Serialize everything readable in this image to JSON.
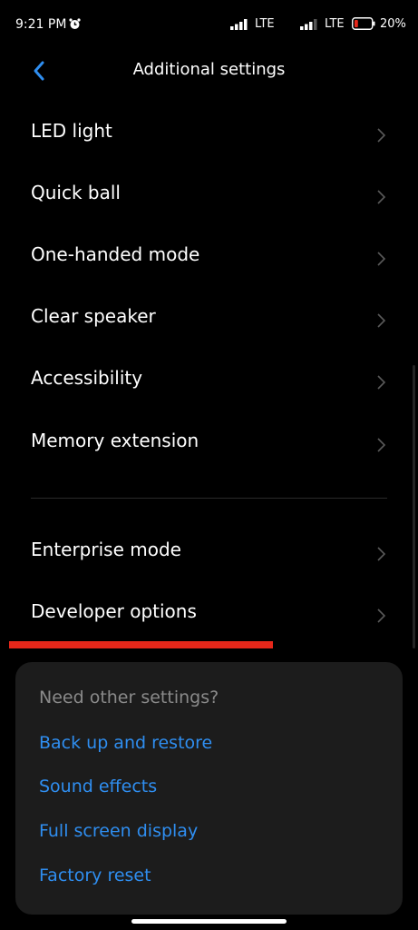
{
  "status_bar": {
    "time": "9:21 PM",
    "network_1": "LTE",
    "network_2": "LTE",
    "battery_percent": "20%",
    "battery_level": 0.2,
    "battery_color": "#e7271a",
    "alarm_icon": "alarm-clock-icon"
  },
  "header": {
    "title": "Additional settings",
    "back_icon": "chevron-left-icon",
    "accent_color": "#2f8ef0"
  },
  "settings": {
    "items": [
      {
        "label": "LED light"
      },
      {
        "label": "Quick ball"
      },
      {
        "label": "One-handed mode"
      },
      {
        "label": "Clear speaker"
      },
      {
        "label": "Accessibility"
      },
      {
        "label": "Memory extension"
      },
      {
        "label": "Enterprise mode"
      },
      {
        "label": "Developer options"
      }
    ]
  },
  "suggestions": {
    "title": "Need other settings?",
    "links": [
      {
        "label": "Back up and restore"
      },
      {
        "label": "Sound effects"
      },
      {
        "label": "Full screen display"
      },
      {
        "label": "Factory reset"
      }
    ]
  }
}
